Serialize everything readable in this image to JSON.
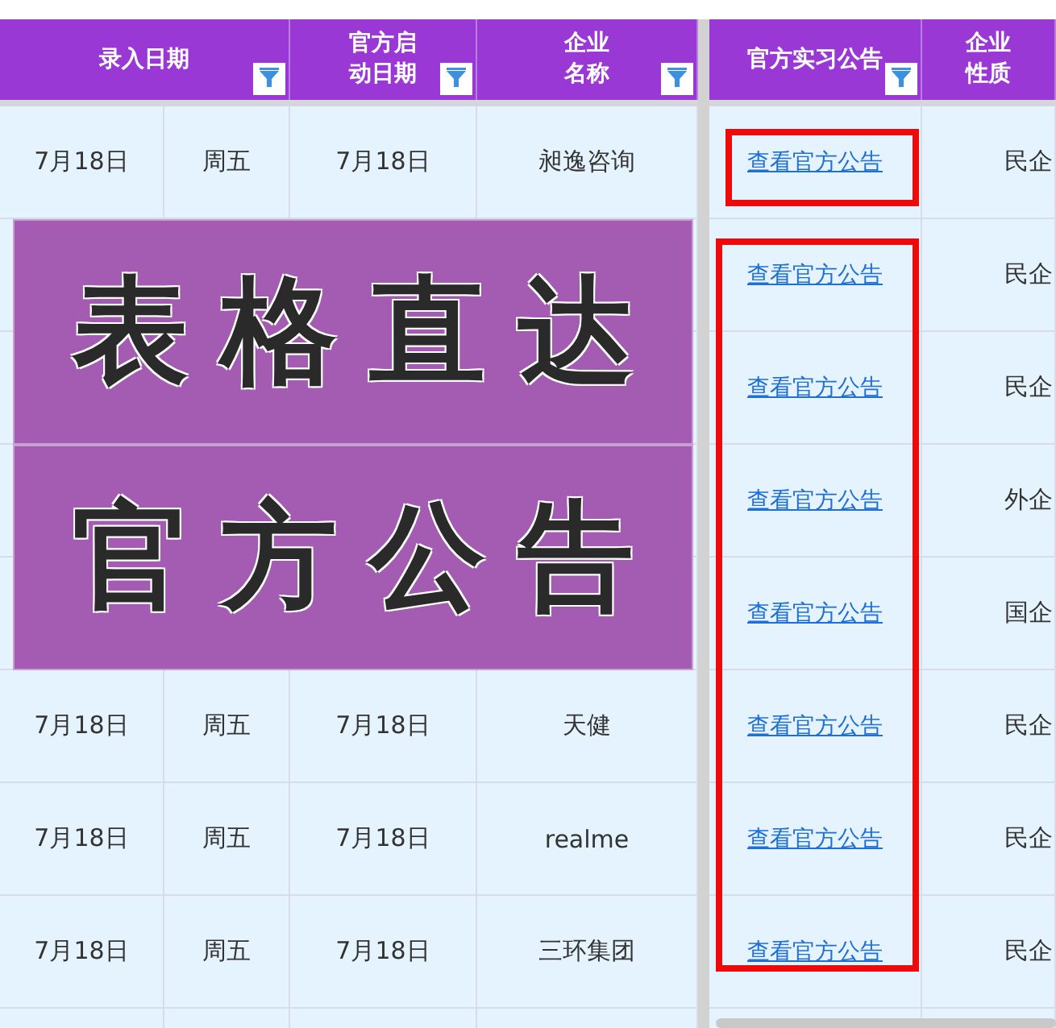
{
  "header": [
    {
      "lines": [
        "录入日期"
      ],
      "kind": "wide",
      "filter": true
    },
    {
      "lines": [
        "官方启",
        "动日期"
      ],
      "kind": "narrow",
      "filter": true
    },
    {
      "lines": [
        "企业",
        "名称"
      ],
      "kind": "narrow",
      "filter": true
    },
    {
      "lines": [
        "官方实习公告"
      ],
      "kind": "narrow",
      "filter": true
    },
    {
      "lines": [
        "企业",
        "性质"
      ],
      "kind": "narrow",
      "filter": false
    }
  ],
  "rows": [
    {
      "entry_date": "7月18日",
      "weekday": "周五",
      "start_date": "7月18日",
      "company": "昶逸咨询",
      "link": "查看官方公告",
      "type": "民企"
    },
    {
      "link": "查看官方公告",
      "type": "民企",
      "banner": "表格直达"
    },
    {
      "link": "查看官方公告",
      "type": "民企"
    },
    {
      "link": "查看官方公告",
      "type": "外企",
      "banner": "官方公告"
    },
    {
      "link": "查看官方公告",
      "type": "国企"
    },
    {
      "entry_date": "7月18日",
      "weekday": "周五",
      "start_date": "7月18日",
      "company": "天健",
      "link": "查看官方公告",
      "type": "民企"
    },
    {
      "entry_date": "7月18日",
      "weekday": "周五",
      "start_date": "7月18日",
      "company": "realme",
      "link": "查看官方公告",
      "type": "民企"
    },
    {
      "entry_date": "7月18日",
      "weekday": "周五",
      "start_date": "7月18日",
      "company": "三环集团",
      "link": "查看官方公告",
      "type": "民企"
    }
  ],
  "callouts": [
    {
      "kind": "single"
    },
    {
      "kind": "rest"
    }
  ]
}
